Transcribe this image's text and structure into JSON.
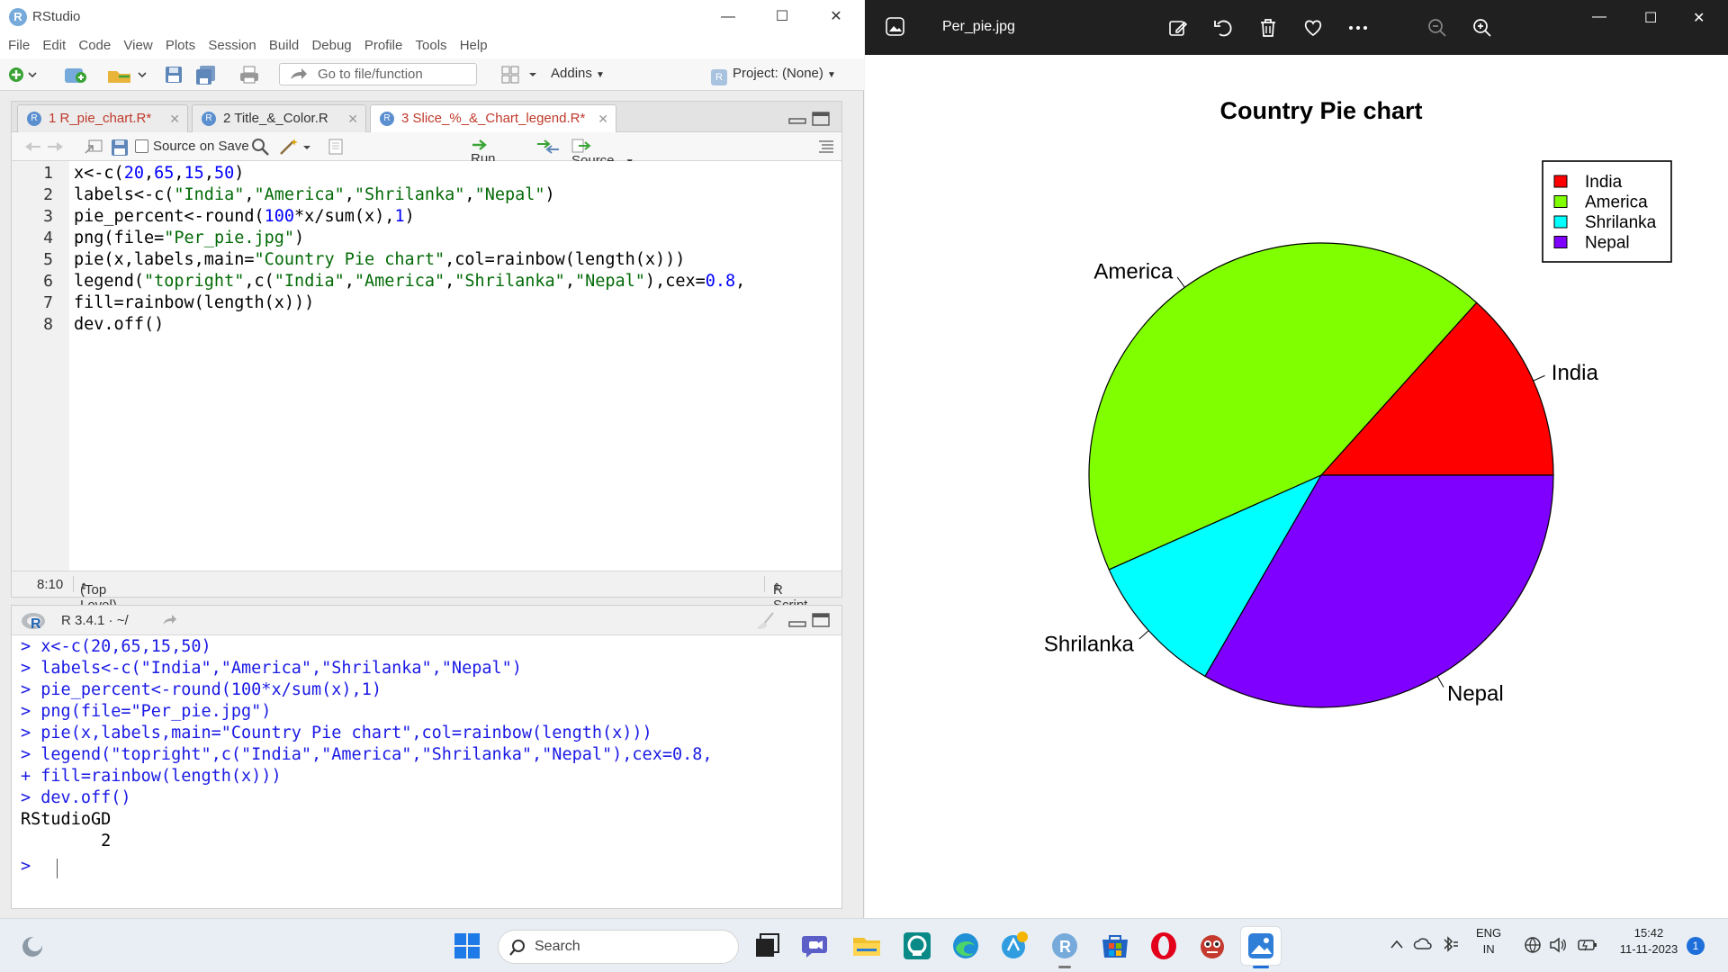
{
  "rstudio": {
    "window_title": "RStudio",
    "menu": [
      "File",
      "Edit",
      "Code",
      "View",
      "Plots",
      "Session",
      "Build",
      "Debug",
      "Profile",
      "Tools",
      "Help"
    ],
    "toolbar": {
      "goto_placeholder": "Go to file/function",
      "addins_label": "Addins",
      "project_label": "Project: (None)"
    },
    "editor": {
      "tabs": [
        {
          "label": "1 R_pie_chart.R*",
          "unsaved": true,
          "active": false
        },
        {
          "label": "2 Title_&_Color.R",
          "unsaved": false,
          "active": false
        },
        {
          "label": "3 Slice_%_&_Chart_legend.R*",
          "unsaved": true,
          "active": true
        }
      ],
      "source_on_save_label": "Source on Save",
      "run_label": "Run",
      "source_label": "Source",
      "line_numbers": [
        "1",
        "2",
        "3",
        "4",
        "5",
        "6",
        "7",
        "8"
      ],
      "code_lines": [
        "x<-c(20,65,15,50)",
        "labels<-c(\"India\",\"America\",\"Shrilanka\",\"Nepal\")",
        "pie_percent<-round(100*x/sum(x),1)",
        "png(file=\"Per_pie.jpg\")",
        "pie(x,labels,main=\"Country Pie chart\",col=rainbow(length(x)))",
        "legend(\"topright\",c(\"India\",\"America\",\"Shrilanka\",\"Nepal\"),cex=0.8,",
        "fill=rainbow(length(x)))",
        "dev.off()"
      ],
      "status_position": "8:10",
      "status_scope": "(Top Level)",
      "status_filetype": "R Script"
    },
    "console": {
      "version": "R 3.4.1 · ~/",
      "lines": [
        {
          "text": "> x<-c(20,65,15,50)",
          "kind": "cmd"
        },
        {
          "text": "> labels<-c(\"India\",\"America\",\"Shrilanka\",\"Nepal\")",
          "kind": "cmd"
        },
        {
          "text": "> pie_percent<-round(100*x/sum(x),1)",
          "kind": "cmd"
        },
        {
          "text": "> png(file=\"Per_pie.jpg\")",
          "kind": "cmd"
        },
        {
          "text": "> pie(x,labels,main=\"Country Pie chart\",col=rainbow(length(x)))",
          "kind": "cmd"
        },
        {
          "text": "> legend(\"topright\",c(\"India\",\"America\",\"Shrilanka\",\"Nepal\"),cex=0.8,",
          "kind": "cmd"
        },
        {
          "text": "+ fill=rainbow(length(x)))",
          "kind": "cmd"
        },
        {
          "text": "> dev.off()",
          "kind": "cmd"
        },
        {
          "text": "RStudioGD",
          "kind": "out"
        },
        {
          "text": "        2",
          "kind": "out"
        },
        {
          "text": "> ",
          "kind": "cmd"
        }
      ]
    }
  },
  "viewer": {
    "file_name": "Per_pie.jpg"
  },
  "chart_data": {
    "type": "pie",
    "title": "Country Pie chart",
    "categories": [
      "India",
      "America",
      "Shrilanka",
      "Nepal"
    ],
    "values": [
      20,
      65,
      15,
      50
    ],
    "colors": [
      "#ff0000",
      "#80ff00",
      "#00ffff",
      "#8000ff"
    ],
    "legend": {
      "position": "top-right",
      "entries": [
        "India",
        "America",
        "Shrilanka",
        "Nepal"
      ]
    },
    "start_angle_deg": 0,
    "direction": "counterclockwise"
  },
  "taskbar": {
    "search_placeholder": "Search",
    "lang_top": "ENG",
    "lang_bottom": "IN",
    "time": "15:42",
    "date": "11-11-2023",
    "notification_count": "1"
  }
}
